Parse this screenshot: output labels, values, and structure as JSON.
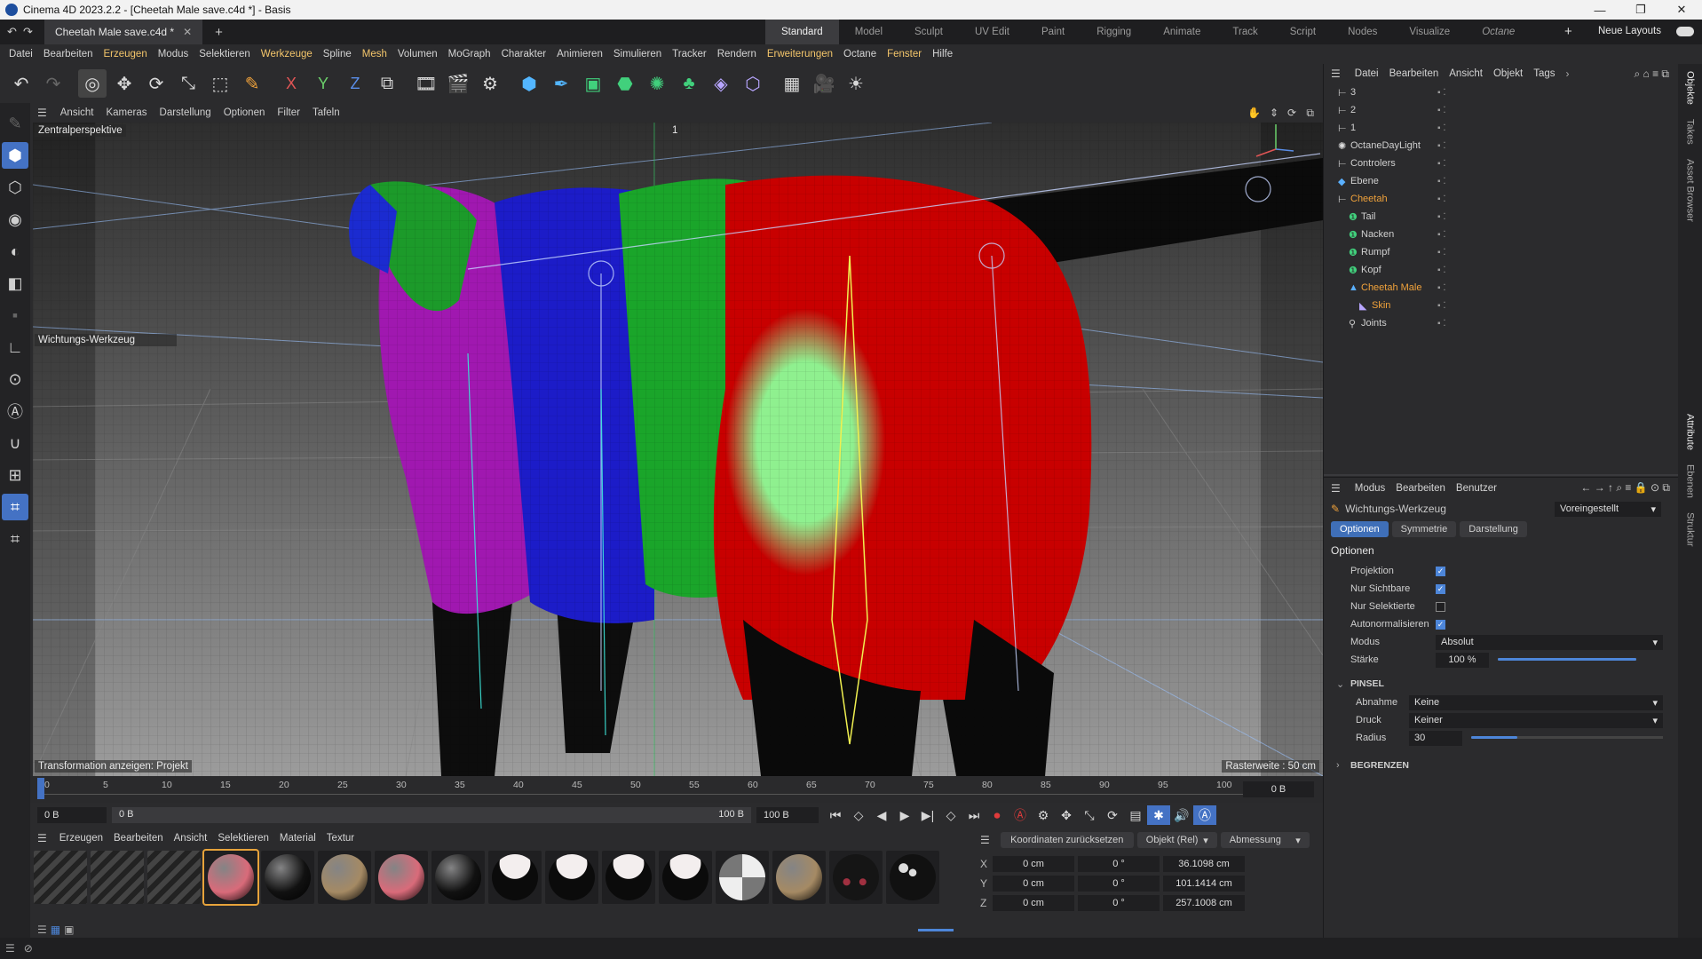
{
  "titlebar": {
    "title": "Cinema 4D 2023.2.2 - [Cheetah Male save.c4d *] - Basis",
    "minimize": "—",
    "maximize": "❐",
    "close": "✕"
  },
  "tabs": {
    "document": "Cheetah Male save.c4d *",
    "close": "✕",
    "add": "+"
  },
  "layouts": {
    "items": [
      "Standard",
      "Model",
      "Sculpt",
      "UV Edit",
      "Paint",
      "Rigging",
      "Animate",
      "Track",
      "Script",
      "Nodes",
      "Visualize",
      "Octane"
    ],
    "active": "Standard",
    "add": "+",
    "new_layouts": "Neue Layouts"
  },
  "menubar": [
    "Datei",
    "Bearbeiten",
    "Erzeugen",
    "Modus",
    "Selektieren",
    "Werkzeuge",
    "Spline",
    "Mesh",
    "Volumen",
    "MoGraph",
    "Charakter",
    "Animieren",
    "Simulieren",
    "Tracker",
    "Rendern",
    "Erweiterungen",
    "Octane",
    "Fenster",
    "Hilfe"
  ],
  "menubar_highlight": [
    "Erzeugen",
    "Werkzeuge",
    "Mesh",
    "Erweiterungen",
    "Fenster"
  ],
  "axis": {
    "x": "X",
    "y": "Y",
    "z": "Z"
  },
  "viewport": {
    "menu": [
      "Ansicht",
      "Kameras",
      "Darstellung",
      "Optionen",
      "Filter",
      "Tafeln"
    ],
    "camera_label": "Zentralperspektive",
    "tool_label": "Wichtungs-Werkzeug",
    "transform_label": "Transformation anzeigen: Projekt",
    "grid_label": "Rasterweite : 50 cm",
    "camera_number": "1"
  },
  "timeline": {
    "ticks": [
      "0",
      "5",
      "10",
      "15",
      "20",
      "25",
      "30",
      "35",
      "40",
      "45",
      "50",
      "55",
      "60",
      "65",
      "70",
      "75",
      "80",
      "85",
      "90",
      "95",
      "100"
    ],
    "current_frame": "0 B",
    "start": "0 B",
    "start2": "0 B",
    "end": "100 B",
    "end2": "100 B"
  },
  "materials": {
    "menu": [
      "Erzeugen",
      "Bearbeiten",
      "Ansicht",
      "Selektieren",
      "Material",
      "Textur"
    ],
    "swatches": [
      {
        "kind": "stripe"
      },
      {
        "kind": "stripe"
      },
      {
        "kind": "stripe"
      },
      {
        "kind": "pink",
        "color": "#d96b7a",
        "selected": true
      },
      {
        "kind": "black",
        "color": "#111111"
      },
      {
        "kind": "fur",
        "color": "#a58a64"
      },
      {
        "kind": "pink",
        "color": "#d96b7a"
      },
      {
        "kind": "black",
        "color": "#111111"
      },
      {
        "kind": "whitecap",
        "color": "#e9e2e2"
      },
      {
        "kind": "whitecap",
        "color": "#e9e2e2"
      },
      {
        "kind": "whitecap",
        "color": "#e9e2e2"
      },
      {
        "kind": "whitecap",
        "color": "#e9e2e2"
      },
      {
        "kind": "checker",
        "color": "#cfcfcf"
      },
      {
        "kind": "fur",
        "color": "#a58a64"
      },
      {
        "kind": "dots",
        "color": "#1a1a1a"
      },
      {
        "kind": "tri",
        "color": "#111111"
      }
    ]
  },
  "coordinates": {
    "reset": "Koordinaten zurücksetzen",
    "mode": "Objekt (Rel)",
    "size_mode": "Abmessung",
    "rows": [
      {
        "axis": "X",
        "pos": "0 cm",
        "rot": "0 °",
        "size": "36.1098 cm"
      },
      {
        "axis": "Y",
        "pos": "0 cm",
        "rot": "0 °",
        "size": "101.1414 cm"
      },
      {
        "axis": "Z",
        "pos": "0 cm",
        "rot": "0 °",
        "size": "257.1008 cm"
      }
    ]
  },
  "objects": {
    "menu": [
      "Datei",
      "Bearbeiten",
      "Ansicht",
      "Objekt",
      "Tags"
    ],
    "items": [
      {
        "name": "3",
        "indent": 0,
        "icon": "null-icon",
        "orange": false
      },
      {
        "name": "2",
        "indent": 0,
        "icon": "null-icon",
        "orange": false
      },
      {
        "name": "1",
        "indent": 0,
        "icon": "null-icon",
        "orange": false
      },
      {
        "name": "OctaneDayLight",
        "indent": 0,
        "icon": "light-icon",
        "orange": false
      },
      {
        "name": "Controlers",
        "indent": 0,
        "icon": "null-icon",
        "orange": false
      },
      {
        "name": "Ebene",
        "indent": 0,
        "icon": "plane-icon",
        "orange": false
      },
      {
        "name": "Cheetah",
        "indent": 0,
        "icon": "null-icon",
        "orange": true
      },
      {
        "name": "Tail",
        "indent": 1,
        "icon": "spline-icon",
        "orange": false
      },
      {
        "name": "Nacken",
        "indent": 1,
        "icon": "spline-icon",
        "orange": false
      },
      {
        "name": "Rumpf",
        "indent": 1,
        "icon": "spline-icon",
        "orange": false
      },
      {
        "name": "Kopf",
        "indent": 1,
        "icon": "spline-icon",
        "orange": false
      },
      {
        "name": "Cheetah Male",
        "indent": 1,
        "icon": "mesh-icon",
        "orange": true
      },
      {
        "name": "Skin",
        "indent": 2,
        "icon": "skin-icon",
        "orange": true
      },
      {
        "name": "Joints",
        "indent": 1,
        "icon": "joint-icon",
        "orange": false
      }
    ]
  },
  "attributes": {
    "menu": [
      "Modus",
      "Bearbeiten",
      "Benutzer"
    ],
    "tool_name": "Wichtungs-Werkzeug",
    "preset": "Voreingestellt",
    "tabs": [
      "Optionen",
      "Symmetrie",
      "Darstellung"
    ],
    "active_tab": "Optionen",
    "section": "Optionen",
    "checkboxes": [
      {
        "label": "Projektion",
        "checked": true
      },
      {
        "label": "Nur Sichtbare",
        "checked": true
      },
      {
        "label": "Nur Selektierte",
        "checked": false
      },
      {
        "label": "Autonormalisieren",
        "checked": true
      }
    ],
    "modus_label": "Modus",
    "modus_value": "Absolut",
    "staerke_label": "Stärke",
    "staerke_value": "100 %",
    "staerke_level": 1.0,
    "pinsel_section": "PINSEL",
    "abnahme_label": "Abnahme",
    "abnahme_value": "Keine",
    "druck_label": "Druck",
    "druck_value": "Keiner",
    "radius_label": "Radius",
    "radius_value": "30",
    "radius_level": 0.24,
    "begrenzen_section": "BEGRENZEN"
  },
  "side_tabs": [
    "Objekte",
    "Takes",
    "Asset Browser"
  ],
  "side_tabs_lower": [
    "Attribute",
    "Ebenen",
    "Struktur"
  ]
}
